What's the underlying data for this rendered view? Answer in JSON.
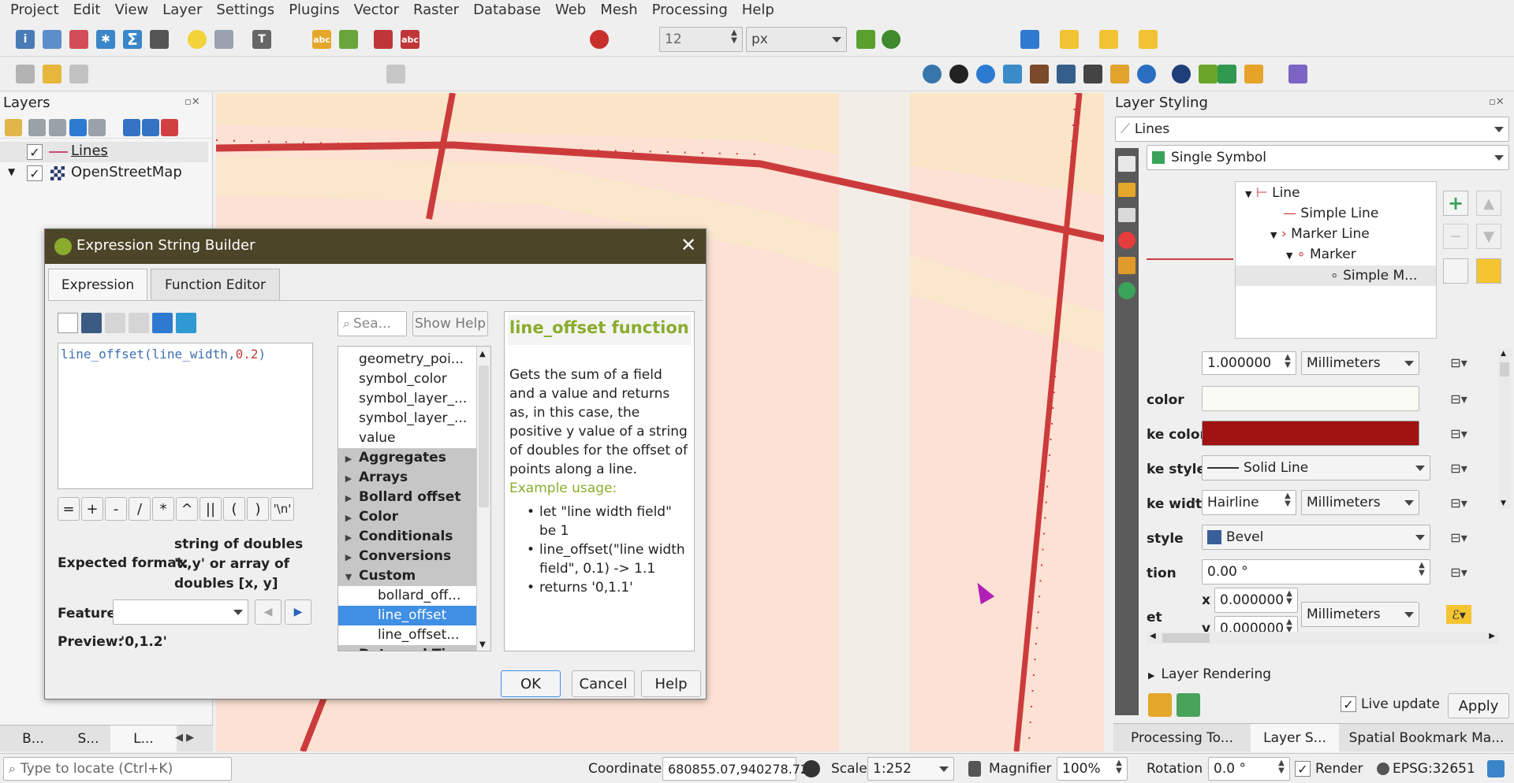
{
  "menu": [
    "Project",
    "Edit",
    "View",
    "Layer",
    "Settings",
    "Plugins",
    "Vector",
    "Raster",
    "Database",
    "Web",
    "Mesh",
    "Processing",
    "Help"
  ],
  "toolbar": {
    "font_size_value": "12",
    "font_unit": "px"
  },
  "layers_panel": {
    "title": "Layers",
    "items": [
      {
        "name": "Lines",
        "checked": true
      },
      {
        "name": "OpenStreetMap",
        "checked": true
      }
    ],
    "bottom_tabs": [
      "B...",
      "S...",
      "L..."
    ]
  },
  "dialog": {
    "title": "Expression String Builder",
    "tabs": [
      "Expression",
      "Function Editor"
    ],
    "expression": {
      "fn": "line_offset",
      "open": "(",
      "arg": "line_width",
      "comma": ",",
      "num": "0.2",
      "close": ")"
    },
    "operators": [
      "=",
      "+",
      "-",
      "/",
      "*",
      "^",
      "||",
      "(",
      ")",
      "'\\n'"
    ],
    "search_placeholder": "Sea...",
    "show_help": "Show Help",
    "function_list": [
      {
        "label": "geometry_poi...",
        "group": false,
        "indent": false
      },
      {
        "label": "symbol_color",
        "group": false,
        "indent": false
      },
      {
        "label": "symbol_layer_...",
        "group": false,
        "indent": false
      },
      {
        "label": "symbol_layer_...",
        "group": false,
        "indent": false
      },
      {
        "label": "value",
        "group": false,
        "indent": false
      },
      {
        "label": "Aggregates",
        "group": true,
        "expanded": false
      },
      {
        "label": "Arrays",
        "group": true,
        "expanded": false
      },
      {
        "label": "Bollard offset",
        "group": true,
        "expanded": false
      },
      {
        "label": "Color",
        "group": true,
        "expanded": false
      },
      {
        "label": "Conditionals",
        "group": true,
        "expanded": false
      },
      {
        "label": "Conversions",
        "group": true,
        "expanded": false
      },
      {
        "label": "Custom",
        "group": true,
        "expanded": true
      },
      {
        "label": "bollard_off...",
        "group": false,
        "indent": true
      },
      {
        "label": "line_offset",
        "group": false,
        "indent": true,
        "selected": true
      },
      {
        "label": "line_offset...",
        "group": false,
        "indent": true
      },
      {
        "label": "Date and Time",
        "group": true,
        "expanded": false
      }
    ],
    "help_title": "line_offset function",
    "help_text": "Gets the sum of a field and a value and returns as, in this case, the positive y value of a string of doubles for the offset of points along a line.",
    "example_heading": "Example usage:",
    "examples": [
      "let \"line width field\" be 1",
      "line_offset(\"line width field\", 0.1) -> 1.1",
      "returns '0,1.1'"
    ],
    "expected_format_label": "Expected format:",
    "expected_format_value": "string of doubles 'x,y' or array of doubles [x, y]",
    "feature_label": "Feature",
    "preview_label": "Preview:",
    "preview_value": "'0,1.2'",
    "ok": "OK",
    "cancel": "Cancel",
    "help": "Help"
  },
  "styling": {
    "title": "Layer Styling",
    "layer": "Lines",
    "renderer": "Single Symbol",
    "tree": [
      "Line",
      "Simple Line",
      "Marker Line",
      "Marker",
      "Simple M..."
    ],
    "props": [
      {
        "label": "",
        "value": "1.000000",
        "unit": "Millimeters"
      },
      {
        "label": "color",
        "value": "",
        "unit": ""
      },
      {
        "label": "ke color",
        "value": "",
        "unit": ""
      },
      {
        "label": "ke style",
        "value": "Solid Line",
        "unit": ""
      },
      {
        "label": "ke width",
        "value": "Hairline",
        "unit": "Millimeters"
      },
      {
        "label": "style",
        "value": "Bevel",
        "unit": ""
      },
      {
        "label": "tion",
        "value": "0.00 °",
        "unit": ""
      },
      {
        "label": "et",
        "x": "0.000000",
        "y": "0.000000",
        "unit": "Millimeters"
      }
    ],
    "stroke_color": "#a11212",
    "layer_rendering": "Layer Rendering",
    "live_update": "Live update",
    "apply": "Apply",
    "bottom_tabs": [
      "Processing To...",
      "Layer S...",
      "Spatial Bookmark Ma..."
    ]
  },
  "status": {
    "locate_placeholder": "Type to locate (Ctrl+K)",
    "coordinate_label": "Coordinate",
    "coordinate": "680855.07,940278.72",
    "scale_label": "Scale",
    "scale": "1:252",
    "magnifier_label": "Magnifier",
    "magnifier": "100%",
    "rotation_label": "Rotation",
    "rotation": "0.0 °",
    "render": "Render",
    "crs": "EPSG:32651"
  },
  "colors": {
    "map_road": "#cc3b3b",
    "map_area": "#fce1d4",
    "map_band": "#fbe7cc",
    "title_bar": "#4d4528",
    "accent_green": "#8aac2c",
    "selection": "#3f8fe5"
  }
}
